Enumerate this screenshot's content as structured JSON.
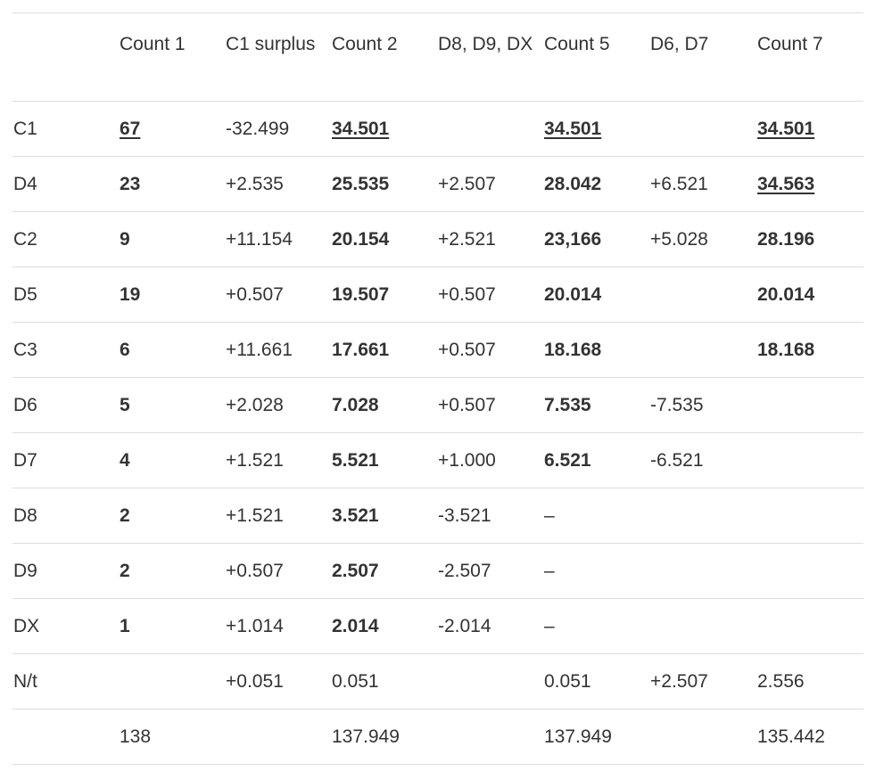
{
  "table": {
    "headers": [
      "",
      "Count 1",
      "C1 surplus",
      "Count 2",
      "D8, D9, DX",
      "Count 5",
      "D6, D7",
      "Count 7"
    ],
    "rows": [
      {
        "label": "C1",
        "cells": [
          {
            "v": "67",
            "s": "underline"
          },
          {
            "v": "-32.499",
            "s": ""
          },
          {
            "v": "34.501",
            "s": "underline"
          },
          {
            "v": "",
            "s": ""
          },
          {
            "v": "34.501",
            "s": "underline"
          },
          {
            "v": "",
            "s": ""
          },
          {
            "v": "34.501",
            "s": "underline"
          }
        ]
      },
      {
        "label": "D4",
        "cells": [
          {
            "v": "23",
            "s": "bold"
          },
          {
            "v": "+2.535",
            "s": ""
          },
          {
            "v": "25.535",
            "s": "bold"
          },
          {
            "v": "+2.507",
            "s": ""
          },
          {
            "v": "28.042",
            "s": "bold"
          },
          {
            "v": "+6.521",
            "s": ""
          },
          {
            "v": "34.563",
            "s": "underline"
          }
        ]
      },
      {
        "label": "C2",
        "cells": [
          {
            "v": "9",
            "s": "bold"
          },
          {
            "v": "+11.154",
            "s": ""
          },
          {
            "v": "20.154",
            "s": "bold"
          },
          {
            "v": "+2.521",
            "s": ""
          },
          {
            "v": "23,166",
            "s": "bold"
          },
          {
            "v": "+5.028",
            "s": ""
          },
          {
            "v": "28.196",
            "s": "bold"
          }
        ]
      },
      {
        "label": "D5",
        "cells": [
          {
            "v": "19",
            "s": "bold"
          },
          {
            "v": "+0.507",
            "s": ""
          },
          {
            "v": "19.507",
            "s": "bold"
          },
          {
            "v": "+0.507",
            "s": ""
          },
          {
            "v": "20.014",
            "s": "bold"
          },
          {
            "v": "",
            "s": ""
          },
          {
            "v": "20.014",
            "s": "bold"
          }
        ]
      },
      {
        "label": "C3",
        "cells": [
          {
            "v": "6",
            "s": "bold"
          },
          {
            "v": "+11.661",
            "s": ""
          },
          {
            "v": "17.661",
            "s": "bold"
          },
          {
            "v": "+0.507",
            "s": ""
          },
          {
            "v": "18.168",
            "s": "bold"
          },
          {
            "v": "",
            "s": ""
          },
          {
            "v": "18.168",
            "s": "bold"
          }
        ]
      },
      {
        "label": "D6",
        "cells": [
          {
            "v": "5",
            "s": "bold"
          },
          {
            "v": "+2.028",
            "s": ""
          },
          {
            "v": "7.028",
            "s": "bold"
          },
          {
            "v": "+0.507",
            "s": ""
          },
          {
            "v": "7.535",
            "s": "bold"
          },
          {
            "v": "-7.535",
            "s": ""
          },
          {
            "v": "",
            "s": ""
          }
        ]
      },
      {
        "label": "D7",
        "cells": [
          {
            "v": "4",
            "s": "bold"
          },
          {
            "v": "+1.521",
            "s": ""
          },
          {
            "v": "5.521",
            "s": "bold"
          },
          {
            "v": "+1.000",
            "s": ""
          },
          {
            "v": "6.521",
            "s": "bold"
          },
          {
            "v": "-6.521",
            "s": ""
          },
          {
            "v": "",
            "s": ""
          }
        ]
      },
      {
        "label": "D8",
        "cells": [
          {
            "v": "2",
            "s": "bold"
          },
          {
            "v": "+1.521",
            "s": ""
          },
          {
            "v": "3.521",
            "s": "bold"
          },
          {
            "v": "-3.521",
            "s": ""
          },
          {
            "v": "–",
            "s": ""
          },
          {
            "v": "",
            "s": ""
          },
          {
            "v": "",
            "s": ""
          }
        ]
      },
      {
        "label": "D9",
        "cells": [
          {
            "v": "2",
            "s": "bold"
          },
          {
            "v": "+0.507",
            "s": ""
          },
          {
            "v": "2.507",
            "s": "bold"
          },
          {
            "v": "-2.507",
            "s": ""
          },
          {
            "v": "–",
            "s": ""
          },
          {
            "v": "",
            "s": ""
          },
          {
            "v": "",
            "s": ""
          }
        ]
      },
      {
        "label": "DX",
        "cells": [
          {
            "v": "1",
            "s": "bold"
          },
          {
            "v": "+1.014",
            "s": ""
          },
          {
            "v": "2.014",
            "s": "bold"
          },
          {
            "v": "-2.014",
            "s": ""
          },
          {
            "v": "–",
            "s": ""
          },
          {
            "v": "",
            "s": ""
          },
          {
            "v": "",
            "s": ""
          }
        ]
      },
      {
        "label": "N/t",
        "cells": [
          {
            "v": "",
            "s": ""
          },
          {
            "v": "+0.051",
            "s": ""
          },
          {
            "v": "0.051",
            "s": ""
          },
          {
            "v": "",
            "s": ""
          },
          {
            "v": "0.051",
            "s": ""
          },
          {
            "v": "+2.507",
            "s": ""
          },
          {
            "v": "2.556",
            "s": ""
          }
        ]
      },
      {
        "label": "",
        "cells": [
          {
            "v": "138",
            "s": ""
          },
          {
            "v": "",
            "s": ""
          },
          {
            "v": "137.949",
            "s": ""
          },
          {
            "v": "",
            "s": ""
          },
          {
            "v": "137.949",
            "s": ""
          },
          {
            "v": "",
            "s": ""
          },
          {
            "v": "135.442",
            "s": ""
          }
        ]
      }
    ]
  },
  "colors": {
    "text": "#333333",
    "rule": "#dddddd",
    "background": "#ffffff"
  }
}
